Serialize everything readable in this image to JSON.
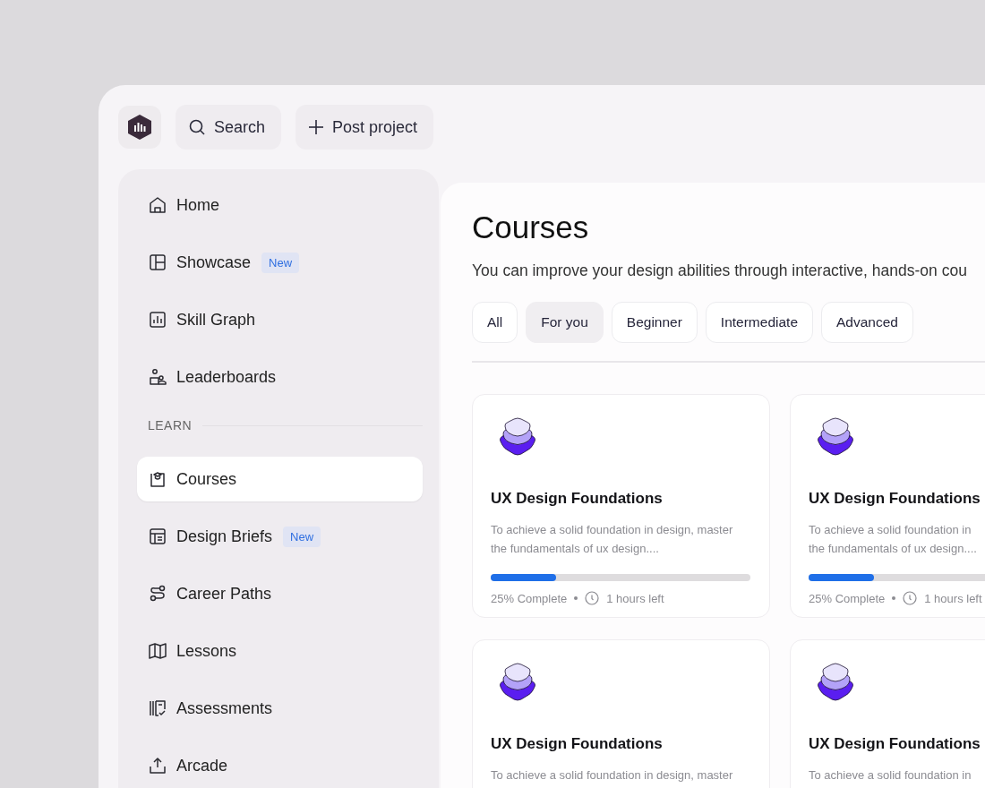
{
  "topbar": {
    "search": "Search",
    "post": "Post project"
  },
  "sidebar": {
    "items": [
      {
        "label": "Home",
        "selected": false
      },
      {
        "label": "Showcase",
        "selected": false,
        "badge": "New"
      },
      {
        "label": "Skill Graph",
        "selected": false
      },
      {
        "label": "Leaderboards",
        "selected": false
      }
    ],
    "section": {
      "label": "LEARN",
      "items": [
        {
          "label": "Courses",
          "selected": true
        },
        {
          "label": "Design Briefs",
          "selected": false,
          "badge": "New"
        },
        {
          "label": "Career Paths",
          "selected": false
        },
        {
          "label": "Lessons",
          "selected": false
        },
        {
          "label": "Assessments",
          "selected": false
        },
        {
          "label": "Arcade",
          "selected": false
        }
      ]
    }
  },
  "main": {
    "title": "Courses",
    "subtitle": "You can improve your design abilities through interactive, hands-on cou",
    "filters": [
      {
        "label": "All",
        "selected": false
      },
      {
        "label": "For you",
        "selected": true
      },
      {
        "label": "Beginner",
        "selected": false
      },
      {
        "label": "Intermediate",
        "selected": false
      },
      {
        "label": "Advanced",
        "selected": false
      }
    ],
    "cards": [
      {
        "title": "UX Design Foundations",
        "description": [
          "To achieve a solid foundation in design, master",
          "the fundamentals of ux design...."
        ],
        "level": 0.25,
        "progress": "25% Complete",
        "time": "1 hours left"
      },
      {
        "title": "UX Design Foundations",
        "description": [
          "To achieve a solid foundation in",
          "the fundamentals of ux design...."
        ],
        "level": 0.25,
        "progress": "25% Complete",
        "time": "1 hours left"
      },
      {
        "title": "UX Design Foundations",
        "description": [
          "To achieve a solid foundation in design, master"
        ]
      },
      {
        "title": "UX Design Foundations",
        "description": [
          "To achieve a solid foundation in"
        ]
      }
    ]
  }
}
